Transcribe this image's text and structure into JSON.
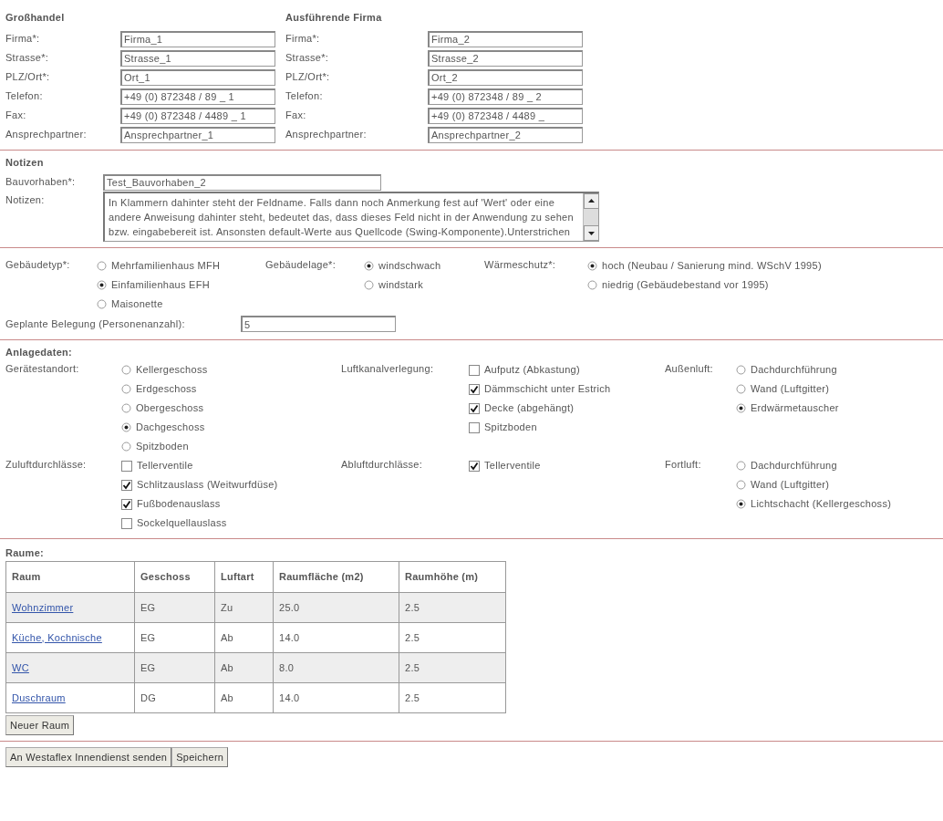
{
  "companies": [
    {
      "title": "Großhandel",
      "fields": [
        {
          "label": "Firma*:",
          "value": "Firma_1"
        },
        {
          "label": "Strasse*:",
          "value": "Strasse_1"
        },
        {
          "label": "PLZ/Ort*:",
          "value": "Ort_1"
        },
        {
          "label": "Telefon:",
          "value": "+49 (0) 872348 / 89 _ 1"
        },
        {
          "label": "Fax:",
          "value": "+49 (0) 872348 / 4489 _ 1"
        },
        {
          "label": "Ansprechpartner:",
          "value": "Ansprechpartner_1"
        }
      ]
    },
    {
      "title": "Ausführende Firma",
      "fields": [
        {
          "label": "Firma*:",
          "value": "Firma_2"
        },
        {
          "label": "Strasse*:",
          "value": "Strasse_2"
        },
        {
          "label": "PLZ/Ort*:",
          "value": "Ort_2"
        },
        {
          "label": "Telefon:",
          "value": "+49 (0) 872348 / 89 _ 2"
        },
        {
          "label": "Fax:",
          "value": "+49 (0) 872348 / 4489 _"
        },
        {
          "label": "Ansprechpartner:",
          "value": "Ansprechpartner_2"
        }
      ]
    }
  ],
  "notes": {
    "title": "Notizen",
    "project": {
      "label": "Bauvorhaben*:",
      "value": "Test_Bauvorhaben_2"
    },
    "text": {
      "label": "Notizen:",
      "value": "In Klammern dahinter steht der Feldname. Falls dann noch Anmerkung fest auf 'Wert' oder eine andere Anweisung dahinter steht, bedeutet das, dass dieses Feld nicht in der Anwendung zu sehen bzw. eingabebereit ist. Ansonsten default-Werte aus Quellcode (Swing-Komponente).Unterstrichen"
    }
  },
  "building": {
    "groups": [
      {
        "label": "Gebäudetyp*:",
        "kind": "radio",
        "options": [
          {
            "label": "Mehrfamilienhaus MFH",
            "selected": false
          },
          {
            "label": "Einfamilienhaus EFH",
            "selected": true
          },
          {
            "label": "Maisonette",
            "selected": false
          }
        ]
      },
      {
        "label": "Gebäudelage*:",
        "kind": "radio",
        "options": [
          {
            "label": "windschwach",
            "selected": true
          },
          {
            "label": "windstark",
            "selected": false
          }
        ]
      },
      {
        "label": "Wärmeschutz*:",
        "kind": "radio",
        "options": [
          {
            "label": "hoch (Neubau / Sanierung mind. WSchV 1995)",
            "selected": true
          },
          {
            "label": "niedrig (Gebäudebestand vor 1995)",
            "selected": false
          }
        ]
      }
    ],
    "occupancy": {
      "label": "Geplante Belegung (Personenanzahl):",
      "value": "5"
    }
  },
  "system": {
    "title": "Anlagedaten:",
    "groups": [
      {
        "label": "Gerätestandort:",
        "kind": "radio",
        "options": [
          {
            "label": "Kellergeschoss",
            "selected": false
          },
          {
            "label": "Erdgeschoss",
            "selected": false
          },
          {
            "label": "Obergeschoss",
            "selected": false
          },
          {
            "label": "Dachgeschoss",
            "selected": true
          },
          {
            "label": "Spitzboden",
            "selected": false
          }
        ]
      },
      {
        "label": "Luftkanalverlegung:",
        "kind": "checkbox",
        "options": [
          {
            "label": "Aufputz (Abkastung)",
            "checked": false
          },
          {
            "label": "Dämmschicht unter Estrich",
            "checked": true
          },
          {
            "label": "Decke (abgehängt)",
            "checked": true
          },
          {
            "label": "Spitzboden",
            "checked": false
          }
        ]
      },
      {
        "label": "Außenluft:",
        "kind": "radio",
        "options": [
          {
            "label": "Dachdurchführung",
            "selected": false
          },
          {
            "label": "Wand (Luftgitter)",
            "selected": false
          },
          {
            "label": "Erdwärmetauscher",
            "selected": true
          }
        ]
      },
      {
        "label": "Zuluftdurchlässe:",
        "kind": "checkbox",
        "options": [
          {
            "label": "Tellerventile",
            "checked": false
          },
          {
            "label": "Schlitzauslass (Weitwurfdüse)",
            "checked": true
          },
          {
            "label": "Fußbodenauslass",
            "checked": true
          },
          {
            "label": "Sockelquellauslass",
            "checked": false
          }
        ]
      },
      {
        "label": "Abluftdurchlässe:",
        "kind": "checkbox",
        "options": [
          {
            "label": "Tellerventile",
            "checked": true
          }
        ]
      },
      {
        "label": "Fortluft:",
        "kind": "radio",
        "options": [
          {
            "label": "Dachdurchführung",
            "selected": false
          },
          {
            "label": "Wand (Luftgitter)",
            "selected": false
          },
          {
            "label": "Lichtschacht (Kellergeschoss)",
            "selected": true
          }
        ]
      }
    ]
  },
  "rooms": {
    "title": "Raume:",
    "columns": [
      "Raum",
      "Geschoss",
      "Luftart",
      "Raumfläche (m2)",
      "Raumhöhe (m)"
    ],
    "rows": [
      [
        "Wohnzimmer",
        "EG",
        "Zu",
        "25.0",
        "2.5"
      ],
      [
        "Küche, Kochnische",
        "EG",
        "Ab",
        "14.0",
        "2.5"
      ],
      [
        "WC",
        "EG",
        "Ab",
        "8.0",
        "2.5"
      ],
      [
        "Duschraum",
        "DG",
        "Ab",
        "14.0",
        "2.5"
      ]
    ],
    "add_button": "Neuer Raum"
  },
  "buttons": [
    "An Westaflex Innendienst senden",
    "Speichern"
  ]
}
